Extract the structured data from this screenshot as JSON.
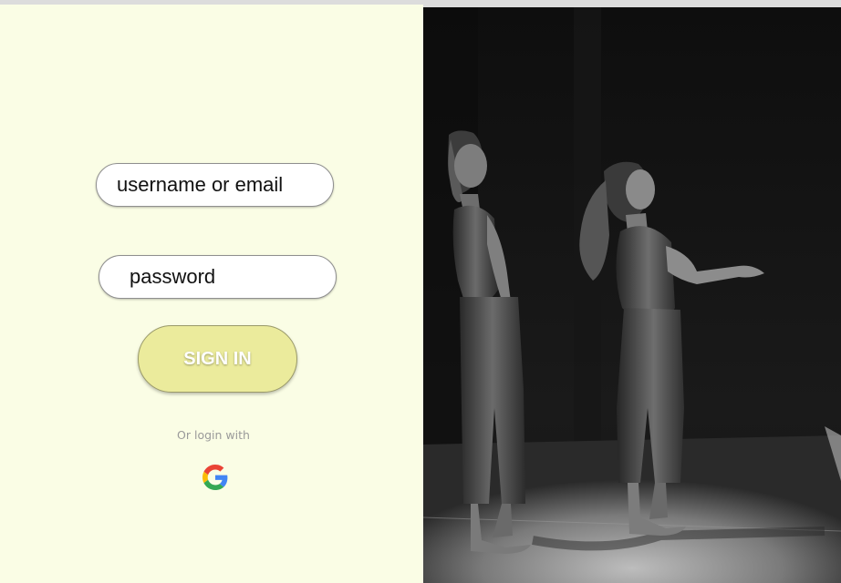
{
  "login": {
    "username_placeholder": "username or email",
    "password_placeholder": "password",
    "sign_in_label": "SIGN IN",
    "alt_login_text": "Or login with",
    "alt_login_provider_icon": "google-icon"
  },
  "photo": {
    "subject": "two dancers on stage, black and white"
  },
  "colors": {
    "panel_background": "#fafde5",
    "sign_in_button": "#ebeb9c",
    "muted_text": "#9a9a9a"
  }
}
